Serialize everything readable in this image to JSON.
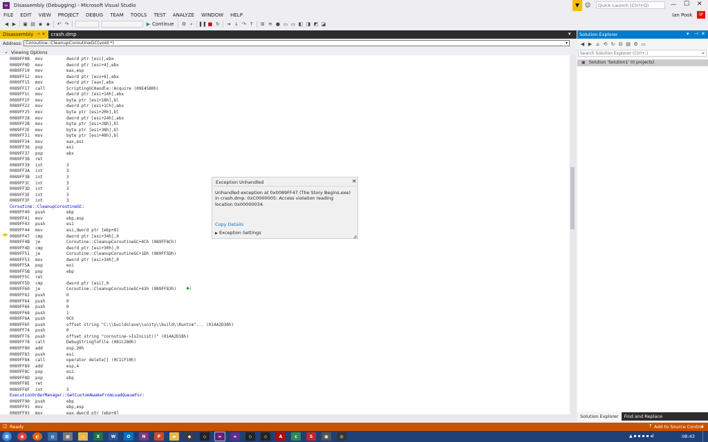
{
  "window": {
    "title": "Disassembly (Debugging) - Microsoft Visual Studio"
  },
  "quick_launch": {
    "placeholder": "Quick Launch (Ctrl+Q)"
  },
  "user": {
    "name": "Ian Pook",
    "initials": "IP"
  },
  "menu": [
    "FILE",
    "EDIT",
    "VIEW",
    "PROJECT",
    "DEBUG",
    "TEAM",
    "TOOLS",
    "TEST",
    "ANALYZE",
    "WINDOW",
    "HELP"
  ],
  "toolbar": {
    "continue_label": "Continue"
  },
  "tabs": [
    {
      "label": "Disassembly"
    },
    {
      "label": "crash.dmp"
    }
  ],
  "address": {
    "label": "Address:",
    "value": "Coroutine::CleanupCoroutineGC(void *)"
  },
  "viewing_options": "Viewing Options",
  "code_lines": [
    {
      "a": "0089FF0B",
      "m": "mov",
      "o": "dword ptr [esi],ebx"
    },
    {
      "a": "0089FF0D",
      "m": "mov",
      "o": "dword ptr [esi+4],ebx"
    },
    {
      "a": "0089FF10",
      "m": "mov",
      "o": "eax,esp"
    },
    {
      "a": "0089FF12",
      "m": "mov",
      "o": "dword ptr [ecx+8],ebx"
    },
    {
      "a": "0089FF15",
      "m": "mov",
      "o": "dword ptr [eax],ebx"
    },
    {
      "a": "0089FF17",
      "m": "call",
      "o": "ScriptingGCHandle::Acquire (09E4580h)"
    },
    {
      "a": "0089FF1C",
      "m": "mov",
      "o": "dword ptr [esi+14h],ebx"
    },
    {
      "a": "0089FF1F",
      "m": "mov",
      "o": "byte ptr [esi+18h],bl"
    },
    {
      "a": "0089FF22",
      "m": "mov",
      "o": "dword ptr [esi+1Ch],ebx"
    },
    {
      "a": "0089FF25",
      "m": "mov",
      "o": "byte ptr [esi+20h],bl"
    },
    {
      "a": "0089FF28",
      "m": "mov",
      "o": "dword ptr [esi+24h],ebx"
    },
    {
      "a": "0089FF2B",
      "m": "mov",
      "o": "byte ptr [esi+28h],bl"
    },
    {
      "a": "0089FF2E",
      "m": "mov",
      "o": "byte ptr [esi+38h],bl"
    },
    {
      "a": "0089FF31",
      "m": "mov",
      "o": "byte ptr [esi+48h],bl"
    },
    {
      "a": "0089FF34",
      "m": "mov",
      "o": "eax,esi"
    },
    {
      "a": "0089FF36",
      "m": "pop",
      "o": "esi"
    },
    {
      "a": "0089FF37",
      "m": "pop",
      "o": "ebx"
    },
    {
      "a": "0089FF38",
      "m": "ret",
      "o": ""
    },
    {
      "a": "0089FF39",
      "m": "int",
      "o": "3"
    },
    {
      "a": "0089FF3A",
      "m": "int",
      "o": "3"
    },
    {
      "a": "0089FF3B",
      "m": "int",
      "o": "3"
    },
    {
      "a": "0089FF3C",
      "m": "int",
      "o": "3"
    },
    {
      "a": "0089FF3D",
      "m": "int",
      "o": "3"
    },
    {
      "a": "0089FF3E",
      "m": "int",
      "o": "3"
    },
    {
      "a": "0089FF3F",
      "m": "int",
      "o": "3"
    },
    {
      "label": "Coroutine::CleanupCoroutineGC:"
    },
    {
      "a": "0089FF40",
      "m": "push",
      "o": "ebp"
    },
    {
      "a": "0089FF41",
      "m": "mov",
      "o": "ebp,esp"
    },
    {
      "a": "0089FF43",
      "m": "push",
      "o": "esi"
    },
    {
      "a": "0089FF44",
      "m": "mov",
      "o": "esi,dword ptr [ebp+8]"
    },
    {
      "a": "0089FF47",
      "m": "cmp",
      "o": "dword ptr [esi+34h],0",
      "current": true
    },
    {
      "a": "0089FF4B",
      "m": "je",
      "o": "Coroutine::CleanupCoroutineGC+4Ch (089FF8Ch)"
    },
    {
      "a": "0089FF4D",
      "m": "cmp",
      "o": "dword ptr [esi+30h],0"
    },
    {
      "a": "0089FF51",
      "m": "je",
      "o": "Coroutine::CleanupCoroutineGC+1Dh (089FF5Dh)"
    },
    {
      "a": "0089FF53",
      "m": "mov",
      "o": "dword ptr [esi+34h],0"
    },
    {
      "a": "0089FF5A",
      "m": "pop",
      "o": "esi"
    },
    {
      "a": "0089FF5B",
      "m": "pop",
      "o": "ebp"
    },
    {
      "a": "0089FF5C",
      "m": "ret",
      "o": ""
    },
    {
      "a": "0089FF5D",
      "m": "cmp",
      "o": "dword ptr [esi],0"
    },
    {
      "a": "0089FF60",
      "m": "je",
      "o": "Coroutine::CleanupCoroutineGC+43h (089FF83h)"
    },
    {
      "a": "0089FF62",
      "m": "push",
      "o": "0"
    },
    {
      "a": "0089FF64",
      "m": "push",
      "o": "0"
    },
    {
      "a": "0089FF66",
      "m": "push",
      "o": "0"
    },
    {
      "a": "0089FF68",
      "m": "push",
      "o": "1"
    },
    {
      "a": "0089FF6A",
      "m": "push",
      "o": "9Ch"
    },
    {
      "a": "0089FF6F",
      "m": "push",
      "o": "offset string \"C:\\\\buildslave\\\\unity\\\\build\\\\Runtim\"... (014A2D30h)"
    },
    {
      "a": "0089FF74",
      "m": "push",
      "o": "0"
    },
    {
      "a": "0089FF76",
      "m": "push",
      "o": "offset string \"coroutine->IsInList()\" (014A2D18h)"
    },
    {
      "a": "0089FF78",
      "m": "call",
      "o": "DebugStringToFile (081C280h)"
    },
    {
      "a": "0089FF80",
      "m": "add",
      "o": "esp,20h"
    },
    {
      "a": "0089FF83",
      "m": "push",
      "o": "esi"
    },
    {
      "a": "0089FF84",
      "m": "call",
      "o": "operator delete[] (0C1CF10h)"
    },
    {
      "a": "0089FF89",
      "m": "add",
      "o": "esp,4"
    },
    {
      "a": "0089FF8C",
      "m": "pop",
      "o": "esi"
    },
    {
      "a": "0089FF8D",
      "m": "pop",
      "o": "ebp"
    },
    {
      "a": "0089FF8E",
      "m": "ret",
      "o": ""
    },
    {
      "a": "0089FF8F",
      "m": "int",
      "o": "3"
    },
    {
      "label": "ExecutionOrderManager::GetCustomAwakeFromLoadQueueFor:"
    },
    {
      "a": "0089FF90",
      "m": "push",
      "o": "ebp"
    },
    {
      "a": "0089FF91",
      "m": "mov",
      "o": "ebp,esp"
    },
    {
      "a": "0089FF93",
      "m": "mov",
      "o": "eax,dword ptr [ebp+8]"
    }
  ],
  "exception": {
    "title": "Exception Unhandled",
    "message": "Unhandled exception at 0x0089FF47 (The Story Begins.exe) in crash.dmp: 0xC0000005: Access violation reading location 0x00000034.",
    "copy_details": "Copy Details",
    "settings": "Exception Settings"
  },
  "solution_explorer": {
    "title": "Solution Explorer",
    "search_placeholder": "Search Solution Explorer (Ctrl+;)",
    "item": "Solution 'Solution1' (0 projects)",
    "bottom_tabs": [
      "Solution Explorer",
      "Find and Replace"
    ]
  },
  "status": {
    "ready": "Ready",
    "source_control": "Add to Source Control"
  },
  "taskbar": {
    "time": "08:43"
  },
  "colors": {
    "accent": "#007acc",
    "status": "#ca5100",
    "taskbar": "#1f3f77"
  }
}
